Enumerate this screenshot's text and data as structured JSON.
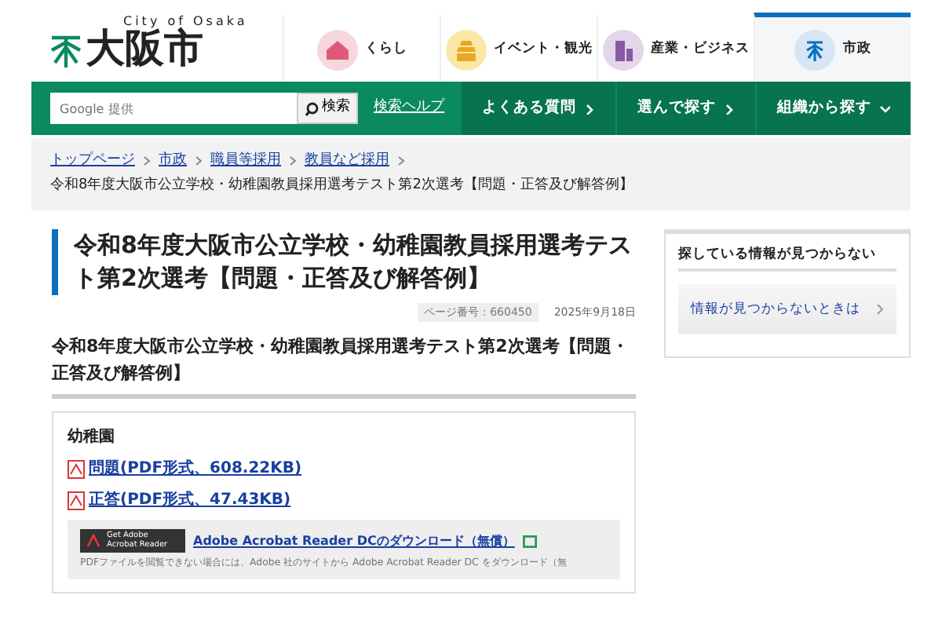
{
  "logo": {
    "tagline": "City of Osaka",
    "name": "大阪市"
  },
  "top_nav": [
    {
      "label": "くらし",
      "selected": false
    },
    {
      "label": "イベント・観光",
      "selected": false
    },
    {
      "label": "産業・ビジネス",
      "selected": false
    },
    {
      "label": "市政",
      "selected": true
    }
  ],
  "search": {
    "placeholder": "Google 提供",
    "button": "検索",
    "help": "検索ヘルプ"
  },
  "green_nav": [
    {
      "label": "よくある質問",
      "kind": "link"
    },
    {
      "label": "選んで探す",
      "kind": "link"
    },
    {
      "label": "組織から探す",
      "kind": "menu"
    }
  ],
  "breadcrumb": {
    "links": [
      "トップページ",
      "市政",
      "職員等採用",
      "教員など採用"
    ],
    "current": "令和8年度大阪市公立学校・幼稚園教員採用選考テスト第2次選考【問題・正答及び解答例】"
  },
  "title": "令和8年度大阪市公立学校・幼稚園教員採用選考テスト第2次選考【問題・正答及び解答例】",
  "page_number": "ページ番号：660450",
  "date": "2025年9月18日",
  "subtitle": "令和8年度大阪市公立学校・幼稚園教員採用選考テスト第2次選考【問題・正答及び解答例】",
  "section": {
    "heading": "幼稚園",
    "files": [
      "問題(PDF形式、608.22KB)",
      "正答(PDF形式、47.43KB)"
    ]
  },
  "acrobat": {
    "badge_line1": "Get Adobe",
    "badge_line2": "Acrobat Reader",
    "link": "Adobe Acrobat Reader DCのダウンロード（無償）",
    "note": "PDFファイルを閲覧できない場合には、Adobe 社のサイトから Adobe Acrobat Reader DC をダウンロード（無"
  },
  "sidebar": {
    "heading": "探している情報が見つからない",
    "link": "情報が見つからないときは"
  }
}
